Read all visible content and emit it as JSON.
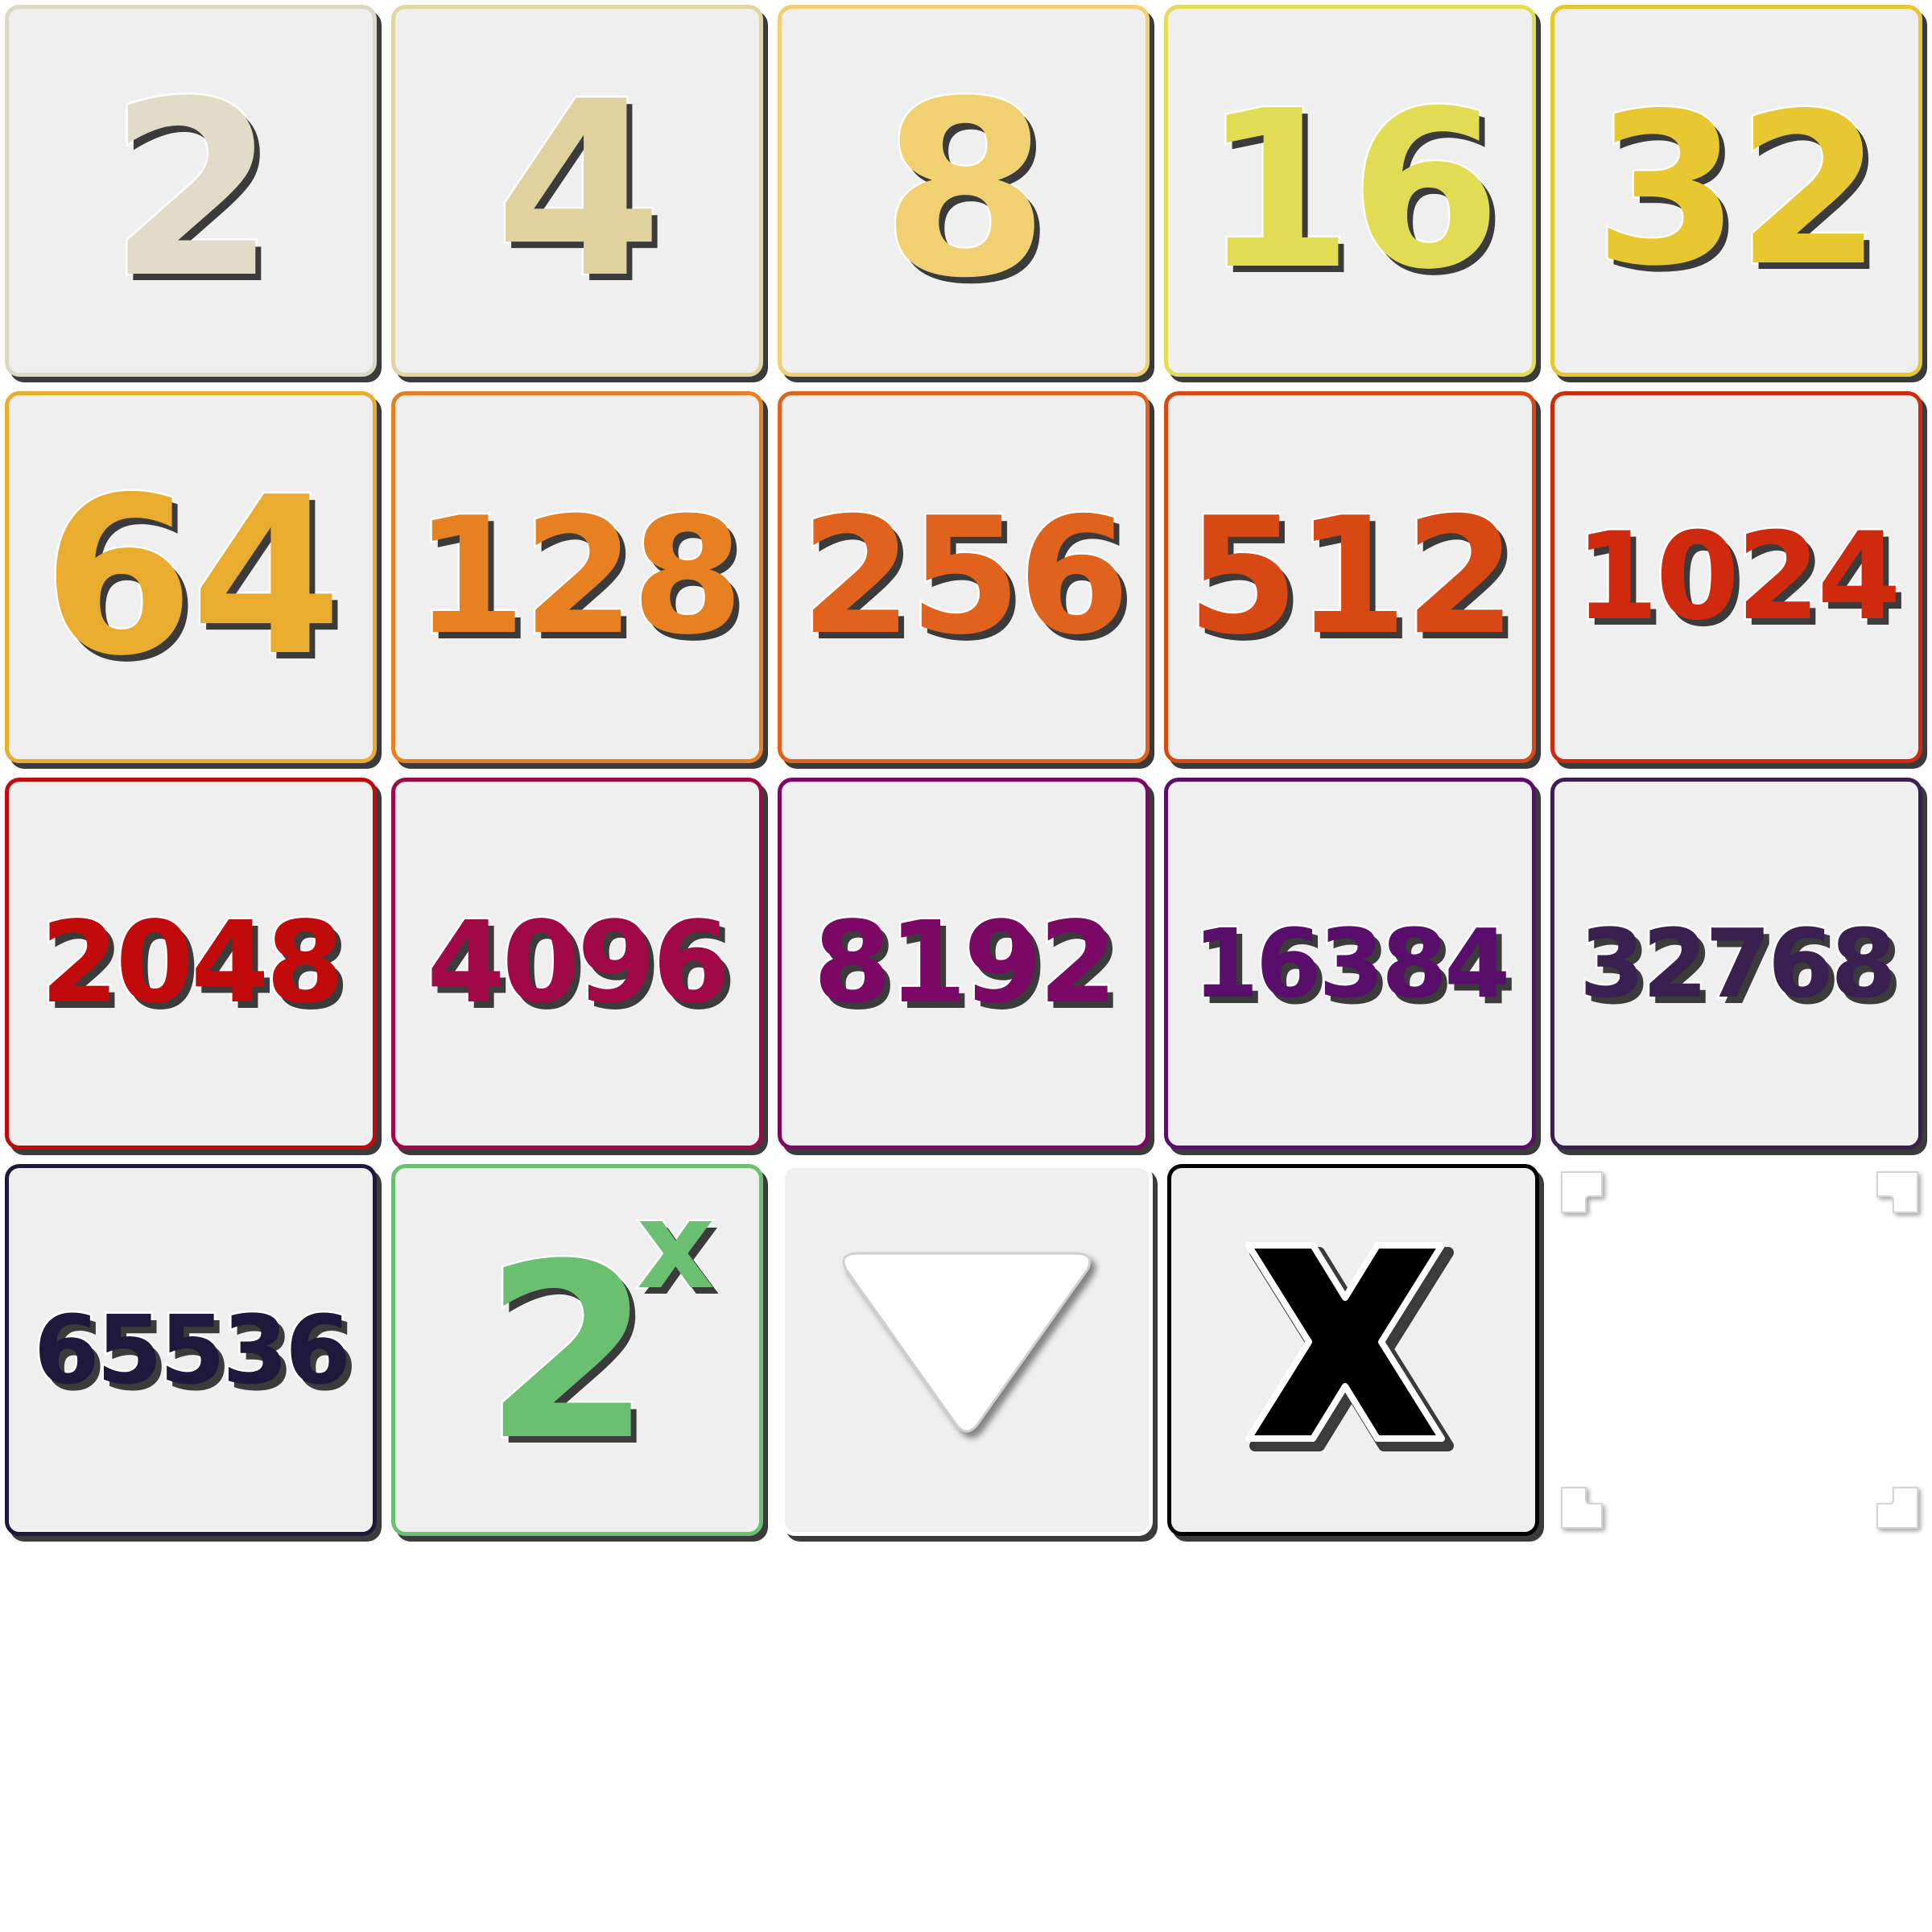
{
  "tiles": [
    {
      "id": "tile-2",
      "label": "2",
      "color": "#e0dcc8",
      "border": "#dcd8c6",
      "size": 300
    },
    {
      "id": "tile-4",
      "label": "4",
      "color": "#e0d29e",
      "border": "#e2d5a2",
      "size": 300
    },
    {
      "id": "tile-8",
      "label": "8",
      "color": "#f0d070",
      "border": "#f0cf72",
      "size": 300
    },
    {
      "id": "tile-16",
      "label": "16",
      "color": "#e2dc55",
      "border": "#e2dc55",
      "size": 270
    },
    {
      "id": "tile-32",
      "label": "32",
      "color": "#e8c830",
      "border": "#e8c830",
      "size": 260
    },
    {
      "id": "tile-64",
      "label": "64",
      "color": "#eaac2e",
      "border": "#eaac2e",
      "size": 270
    },
    {
      "id": "tile-128",
      "label": "128",
      "color": "#e68020",
      "border": "#e68020",
      "size": 200
    },
    {
      "id": "tile-256",
      "label": "256",
      "color": "#e0621c",
      "border": "#e0621c",
      "size": 200
    },
    {
      "id": "tile-512",
      "label": "512",
      "color": "#d84814",
      "border": "#d84814",
      "size": 200
    },
    {
      "id": "tile-1024",
      "label": "1024",
      "color": "#d02a0e",
      "border": "#d02a0e",
      "size": 150
    },
    {
      "id": "tile-2048",
      "label": "2048",
      "color": "#c00a0c",
      "border": "#c00a0c",
      "size": 140
    },
    {
      "id": "tile-4096",
      "label": "4096",
      "color": "#a00848",
      "border": "#a00848",
      "size": 140
    },
    {
      "id": "tile-8192",
      "label": "8192",
      "color": "#7c0866",
      "border": "#7c0866",
      "size": 140
    },
    {
      "id": "tile-16384",
      "label": "16384",
      "color": "#5a0e6c",
      "border": "#5a0e6c",
      "size": 118
    },
    {
      "id": "tile-32768",
      "label": "32768",
      "color": "#3a2050",
      "border": "#3a2050",
      "size": 118
    },
    {
      "id": "tile-65536",
      "label": "65536",
      "color": "#1e183c",
      "border": "#1e183c",
      "size": 118
    }
  ],
  "special": {
    "power": {
      "base": "2",
      "sup": "x",
      "color": "#6abf70"
    },
    "dropdown": {
      "icon": "triangle-down-icon"
    },
    "close": {
      "icon": "x-icon",
      "color": "#000000"
    },
    "focus": {
      "icon": "corner-brackets-icon"
    }
  }
}
